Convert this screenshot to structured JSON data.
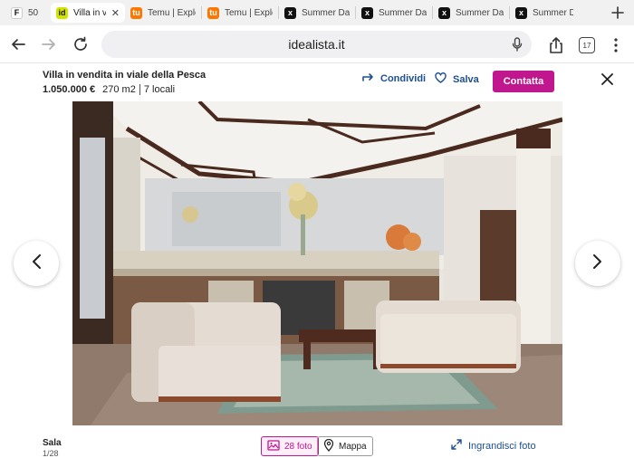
{
  "browser": {
    "tabs": [
      {
        "icon_text": "F",
        "label": "50",
        "active": false
      },
      {
        "icon_text": "id",
        "label": "Villa in v",
        "active": true
      },
      {
        "icon_text": "tu",
        "label": "Temu | Explo",
        "active": false
      },
      {
        "icon_text": "tu",
        "label": "Temu | Explo",
        "active": false
      },
      {
        "icon_text": "x",
        "label": "Summer Day",
        "active": false
      },
      {
        "icon_text": "x",
        "label": "Summer Day",
        "active": false
      },
      {
        "icon_text": "x",
        "label": "Summer Day",
        "active": false
      },
      {
        "icon_text": "x",
        "label": "Summer Day",
        "active": false
      }
    ],
    "url": "idealista.it",
    "tab_count": "17",
    "new_tab_icon": "plus-icon"
  },
  "listing": {
    "title": "Villa in vendita in viale della Pesca",
    "price": "1.050.000 €",
    "area": "270 m2",
    "rooms": "7 locali",
    "share_label": "Condividi",
    "save_label": "Salva",
    "contact_label": "Contatta",
    "accent_color": "#c0168e",
    "link_color": "#1d4f91"
  },
  "gallery": {
    "caption": "Sala",
    "counter": "1/28",
    "photos_label": "28 foto",
    "map_label": "Mappa",
    "enlarge_label": "Ingrandisci foto"
  }
}
